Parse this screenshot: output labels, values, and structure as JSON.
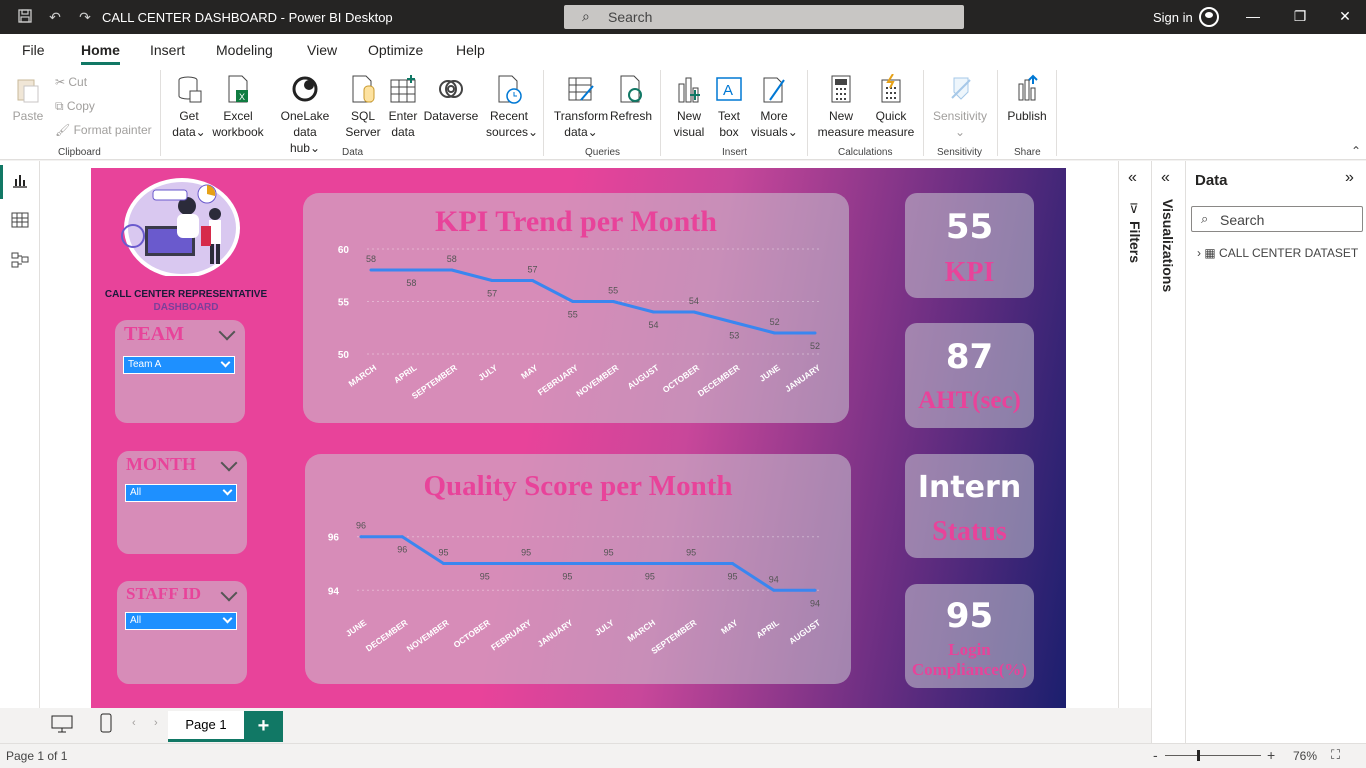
{
  "window": {
    "title": "CALL CENTER DASHBOARD - Power BI Desktop",
    "search_placeholder": "Search",
    "sign_in": "Sign in"
  },
  "menu": [
    "File",
    "Home",
    "Insert",
    "Modeling",
    "View",
    "Optimize",
    "Help"
  ],
  "ribbon": {
    "clipboard": {
      "paste": "Paste",
      "cut": "Cut",
      "copy": "Copy",
      "format_painter": "Format painter",
      "label": "Clipboard"
    },
    "data": {
      "get_data": [
        "Get",
        "data"
      ],
      "excel": [
        "Excel",
        "workbook"
      ],
      "onelake": [
        "OneLake data",
        "hub"
      ],
      "sql": [
        "SQL",
        "Server"
      ],
      "enter": [
        "Enter",
        "data"
      ],
      "dataverse": "Dataverse",
      "recent": [
        "Recent",
        "sources"
      ],
      "label": "Data"
    },
    "queries": {
      "transform": [
        "Transform",
        "data"
      ],
      "refresh": "Refresh",
      "label": "Queries"
    },
    "insert": {
      "new_visual": [
        "New",
        "visual"
      ],
      "text_box": [
        "Text",
        "box"
      ],
      "more_visuals": [
        "More",
        "visuals"
      ],
      "label": "Insert"
    },
    "calculations": {
      "new_measure": [
        "New",
        "measure"
      ],
      "quick_measure": [
        "Quick",
        "measure"
      ],
      "label": "Calculations"
    },
    "sensitivity": {
      "sensitivity": "Sensitivity",
      "label": "Sensitivity"
    },
    "share": {
      "publish": "Publish",
      "label": "Share"
    }
  },
  "report": {
    "logo_text": [
      "CALL CENTER REPRESENTATIVE",
      "DASHBOARD"
    ],
    "slicers": [
      {
        "title": "TEAM",
        "value": "Team A"
      },
      {
        "title": "MONTH",
        "value": "All"
      },
      {
        "title": "STAFF ID",
        "value": "All"
      }
    ],
    "kpis": [
      {
        "value": "55",
        "label": "KPI"
      },
      {
        "value": "87",
        "label": "AHT(sec)"
      },
      {
        "value": "Intern",
        "label": "Status"
      },
      {
        "value": "95",
        "label": "Login Compliance(%)"
      }
    ]
  },
  "chart_data": [
    {
      "type": "line",
      "title": "KPI Trend per Month",
      "categories": [
        "MARCH",
        "APRIL",
        "SEPTEMBER",
        "JULY",
        "MAY",
        "FEBRUARY",
        "NOVEMBER",
        "AUGUST",
        "OCTOBER",
        "DECEMBER",
        "JUNE",
        "JANUARY"
      ],
      "values": [
        58,
        58,
        58,
        57,
        57,
        55,
        55,
        54,
        54,
        53,
        52,
        52
      ],
      "yticks": [
        50,
        55,
        60
      ],
      "ylim": [
        50,
        60
      ],
      "color": "#3a86f0"
    },
    {
      "type": "line",
      "title": "Quality Score per Month",
      "categories": [
        "JUNE",
        "DECEMBER",
        "NOVEMBER",
        "OCTOBER",
        "FEBRUARY",
        "JANUARY",
        "JULY",
        "MARCH",
        "SEPTEMBER",
        "MAY",
        "APRIL",
        "AUGUST"
      ],
      "values": [
        96,
        96,
        95,
        95,
        95,
        95,
        95,
        95,
        95,
        95,
        94,
        94
      ],
      "yticks": [
        94,
        96
      ],
      "ylim": [
        93.6,
        96.4
      ],
      "color": "#3a86f0"
    }
  ],
  "side": {
    "filters": "Filters",
    "visualizations": "Visualizations",
    "data_title": "Data",
    "search_placeholder": "Search",
    "dataset": "CALL CENTER DATASET"
  },
  "pages": {
    "tab": "Page 1",
    "add": "+"
  },
  "status": {
    "page_info": "Page 1 of 1",
    "zoom": "76%"
  }
}
